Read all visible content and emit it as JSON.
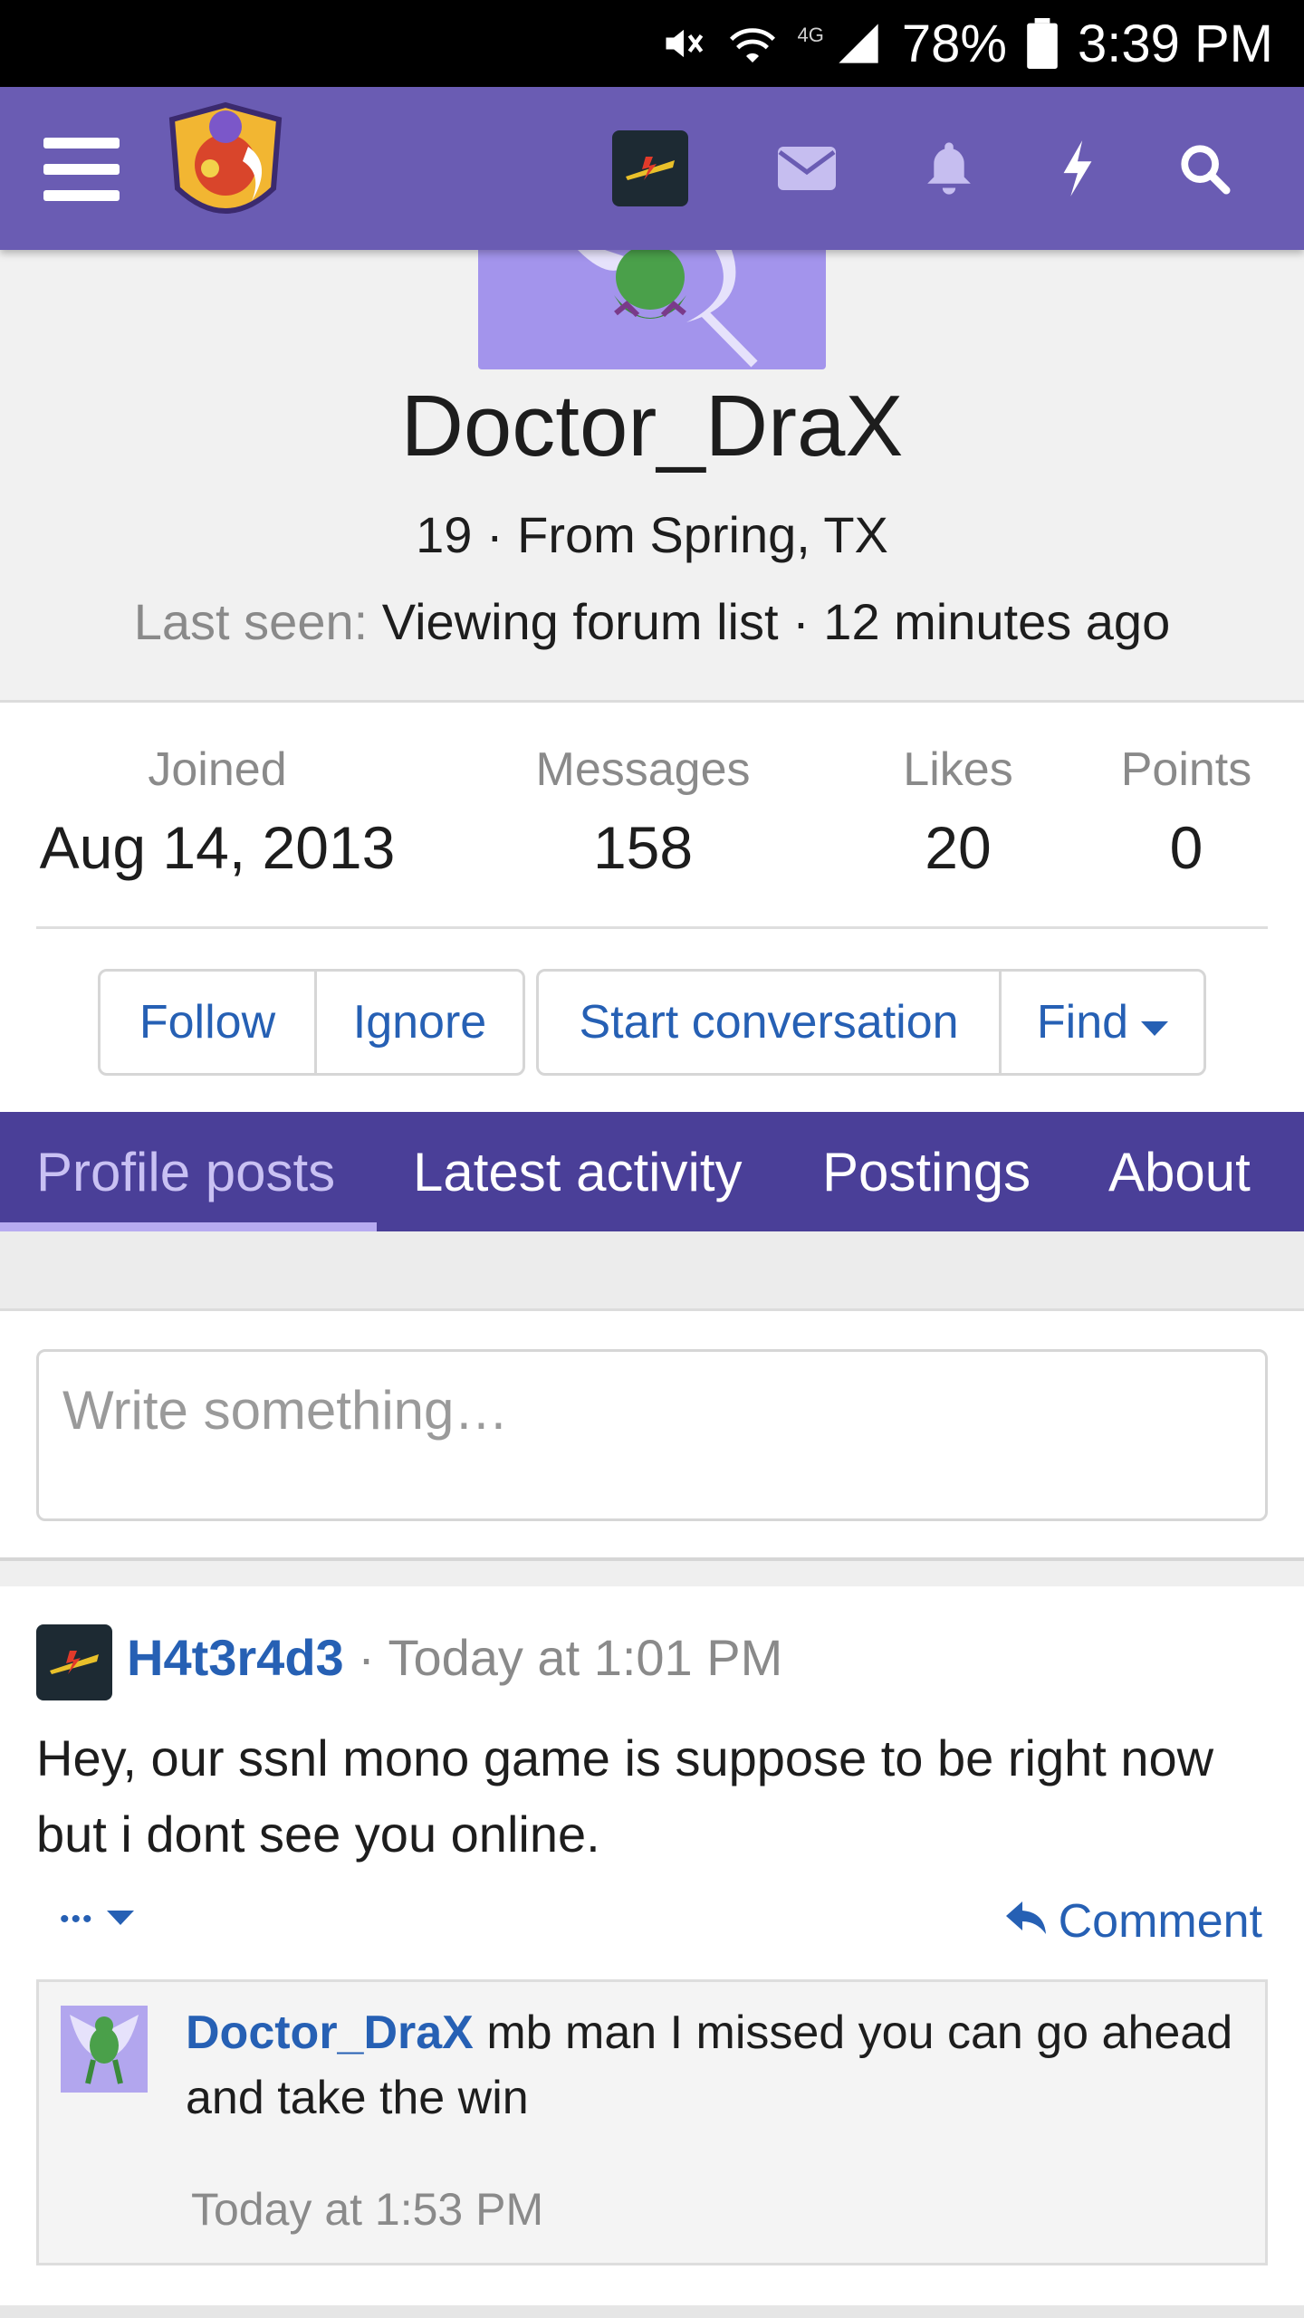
{
  "status_bar": {
    "battery": "78%",
    "time": "3:39 PM",
    "network": "4G"
  },
  "app_header": {
    "icons": [
      "menu-icon",
      "site-logo",
      "user-avatar",
      "mail-icon",
      "bell-icon",
      "bolt-icon",
      "search-icon"
    ],
    "color": "#6a5cb3"
  },
  "profile": {
    "name": "Doctor_DraX",
    "meta": "19 · From Spring, TX",
    "last_seen_label": "Last seen:",
    "last_seen_value": " Viewing forum list · 12 minutes ago"
  },
  "stats": [
    {
      "label": "Joined",
      "value": "Aug 14, 2013"
    },
    {
      "label": "Messages",
      "value": "158"
    },
    {
      "label": "Likes",
      "value": "20"
    },
    {
      "label": "Points",
      "value": "0"
    }
  ],
  "actions": {
    "follow": "Follow",
    "ignore": "Ignore",
    "start_conversation": "Start conversation",
    "find": "Find"
  },
  "tabs": [
    {
      "label": "Profile posts",
      "active": true
    },
    {
      "label": "Latest activity",
      "active": false
    },
    {
      "label": "Postings",
      "active": false
    },
    {
      "label": "About",
      "active": false
    }
  ],
  "composer": {
    "placeholder": "Write something…"
  },
  "post": {
    "author": "H4t3r4d3",
    "separator": " · ",
    "time": "Today at 1:01 PM",
    "body": "Hey, our ssnl mono game is suppose to be right now but i dont see you online.",
    "more": "•••",
    "comment": "Comment",
    "reply": {
      "author": "Doctor_DraX",
      "text": " mb man I missed you can go ahead and take the win",
      "time": "Today at 1:53 PM"
    }
  },
  "colors": {
    "header": "#6a5cb3",
    "tabs": "#4a3f98",
    "link": "#2660b4",
    "avatar_bg": "#a394ec"
  }
}
